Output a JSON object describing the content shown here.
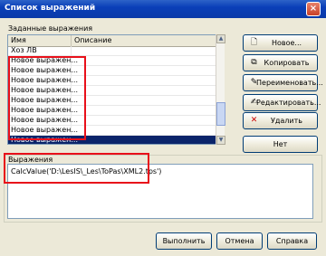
{
  "window": {
    "title": "Список выражений",
    "close_label": "×"
  },
  "list": {
    "caption": "Заданные выражения",
    "columns": [
      "Имя",
      "Описание"
    ],
    "rows": [
      {
        "name": "Хоз ЛВ"
      },
      {
        "name": "Новое выражен..."
      },
      {
        "name": "Новое выражен..."
      },
      {
        "name": "Новое выражен..."
      },
      {
        "name": "Новое выражен..."
      },
      {
        "name": "Новое выражен..."
      },
      {
        "name": "Новое выражен..."
      },
      {
        "name": "Новое выражен..."
      },
      {
        "name": "Новое выражен..."
      },
      {
        "name": "Новое выражен...",
        "selected": true
      }
    ]
  },
  "side_buttons": {
    "new": "Новое...",
    "copy": "Копировать",
    "rename": "Переименовать...",
    "edit": "Редактировать...",
    "delete": "Удалить",
    "no": "Нет"
  },
  "expression": {
    "caption": "Выражения",
    "value": "CalcValue('D:\\LesIS\\_Les\\ToPas\\XML2.tps')"
  },
  "footer": {
    "run": "Выполнить",
    "cancel": "Отмена",
    "help": "Справка"
  },
  "colors": {
    "selection": "#0a246a",
    "highlight_box": "#e8101a",
    "delete_icon": "#cc0000"
  }
}
